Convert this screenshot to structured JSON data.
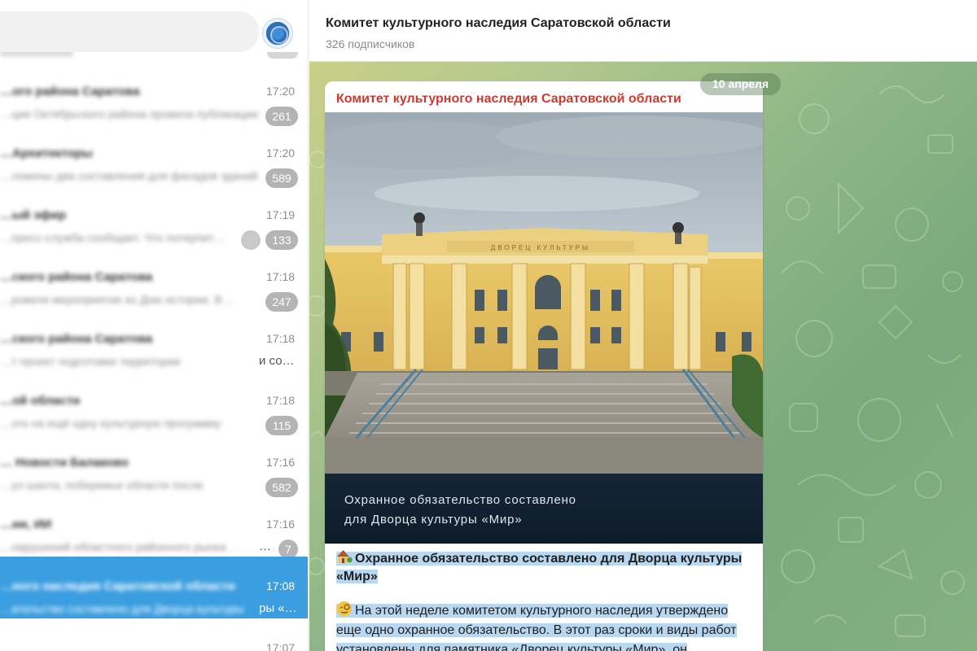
{
  "channel": {
    "title": "Комитет культурного наследия Саратовской области",
    "subscribers": "326 подписчиков"
  },
  "chat_list": [
    {
      "name": "…ого района Саратова",
      "preview": "…ция Октябрьского района провела публикацию",
      "time": "17:20",
      "unread": "261"
    },
    {
      "name": "…Архитекторы",
      "preview": "…ложены два составления для фасадов зданий",
      "time": "17:20",
      "unread": "589"
    },
    {
      "name": "…ый эфир",
      "preview": "…пресс-служба сообщает. Что потерпит…",
      "time": "17:19",
      "unread": "133"
    },
    {
      "name": "…ского района Саратова",
      "preview": "…ровели мероприятие ко Дню истории. В…",
      "time": "17:18",
      "unread": "247"
    },
    {
      "name": "…ского района Саратова",
      "preview": "…т проект подготовки территории",
      "preview_tail": "и со…",
      "time": "17:18",
      "unread": ""
    },
    {
      "name": "…ой области",
      "preview": "…это на ещё одну культурную программу",
      "time": "17:18",
      "unread": "115"
    },
    {
      "name": "… Новости Балаково",
      "preview": "…ул шахта, побережье области после",
      "time": "17:16",
      "unread": "582"
    },
    {
      "name": "…ии, ИИ",
      "preview": "…нарушений областного районного рынка",
      "preview_tail": "…",
      "time": "17:16",
      "unread": "7"
    },
    {
      "name": "…ного наследия Саратовской области",
      "preview": "…ательство составлено для Дворца культуры",
      "preview_tail": "ры «…",
      "time": "17:08",
      "unread": "",
      "active": true
    },
    {
      "name": "",
      "preview": "",
      "time": "17:07",
      "unread": ""
    }
  ],
  "message": {
    "date": "10 апреля",
    "author": "Комитет культурного наследия Саратовской области",
    "image_caption_line1": "Охранное обязательство составлено",
    "image_caption_line2": "для Дворца культуры «Мир»",
    "headline": "Охранное обязательство составлено для Дворца культуры «Мир»",
    "body": "На этой неделе комитетом культурного наследия утверждено еще одно охранное обязательство. В этот раз сроки и виды работ установлены для памятника «Дворец культуры «Мир», он",
    "headline_icon": "house-with-garden-icon",
    "body_icon": "monocle-face-icon",
    "building_sign": "ДВОРЕЦ КУЛЬТУРЫ"
  },
  "colors": {
    "author": "#cc3b30",
    "active_chat": "#3a9ee0",
    "badge": "#b4b4b4",
    "selection": "#b8d7f1"
  }
}
